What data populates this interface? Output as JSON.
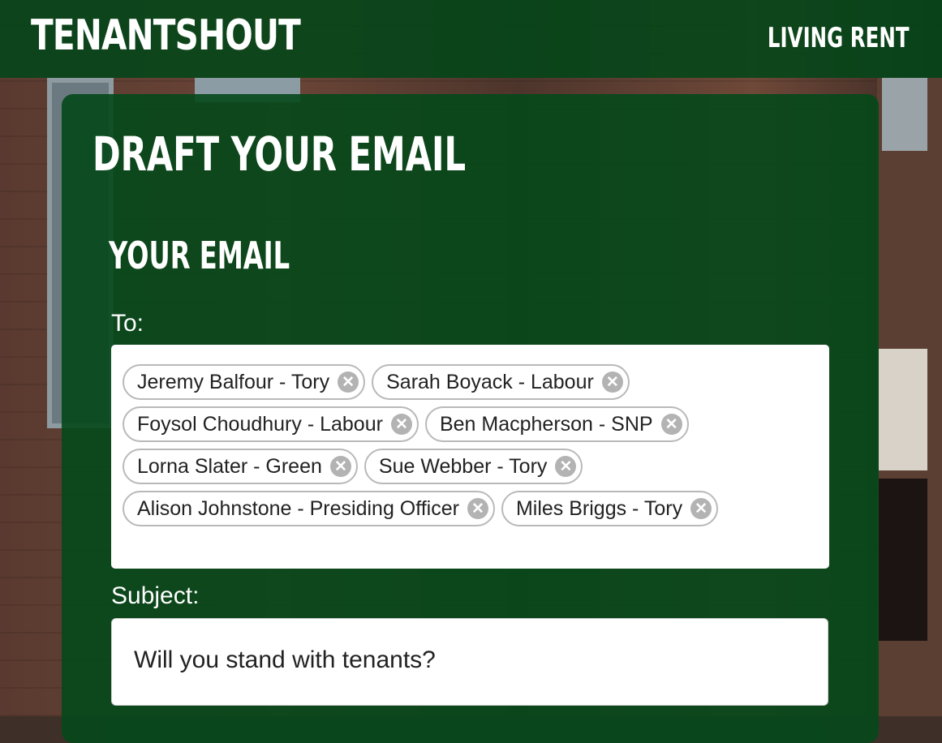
{
  "header": {
    "brand": "TENANTSHOUT",
    "org": "LIVING RENT",
    "bar_color": "#02461a"
  },
  "card": {
    "title": "DRAFT YOUR EMAIL",
    "section_title": "YOUR EMAIL"
  },
  "form": {
    "to_label": "To:",
    "recipients": [
      [
        "Jeremy Balfour - Tory",
        "Sarah Boyack - Labour"
      ],
      [
        "Foysol Choudhury - Labour",
        "Ben Macpherson - SNP"
      ],
      [
        "Lorna Slater - Green",
        "Sue Webber - Tory"
      ],
      [
        "Alison Johnstone - Presiding Officer",
        "Miles Briggs - Tory"
      ]
    ],
    "remove_icon": "close-circle-icon",
    "subject_label": "Subject:",
    "subject_value": "Will you stand with tenants?"
  }
}
